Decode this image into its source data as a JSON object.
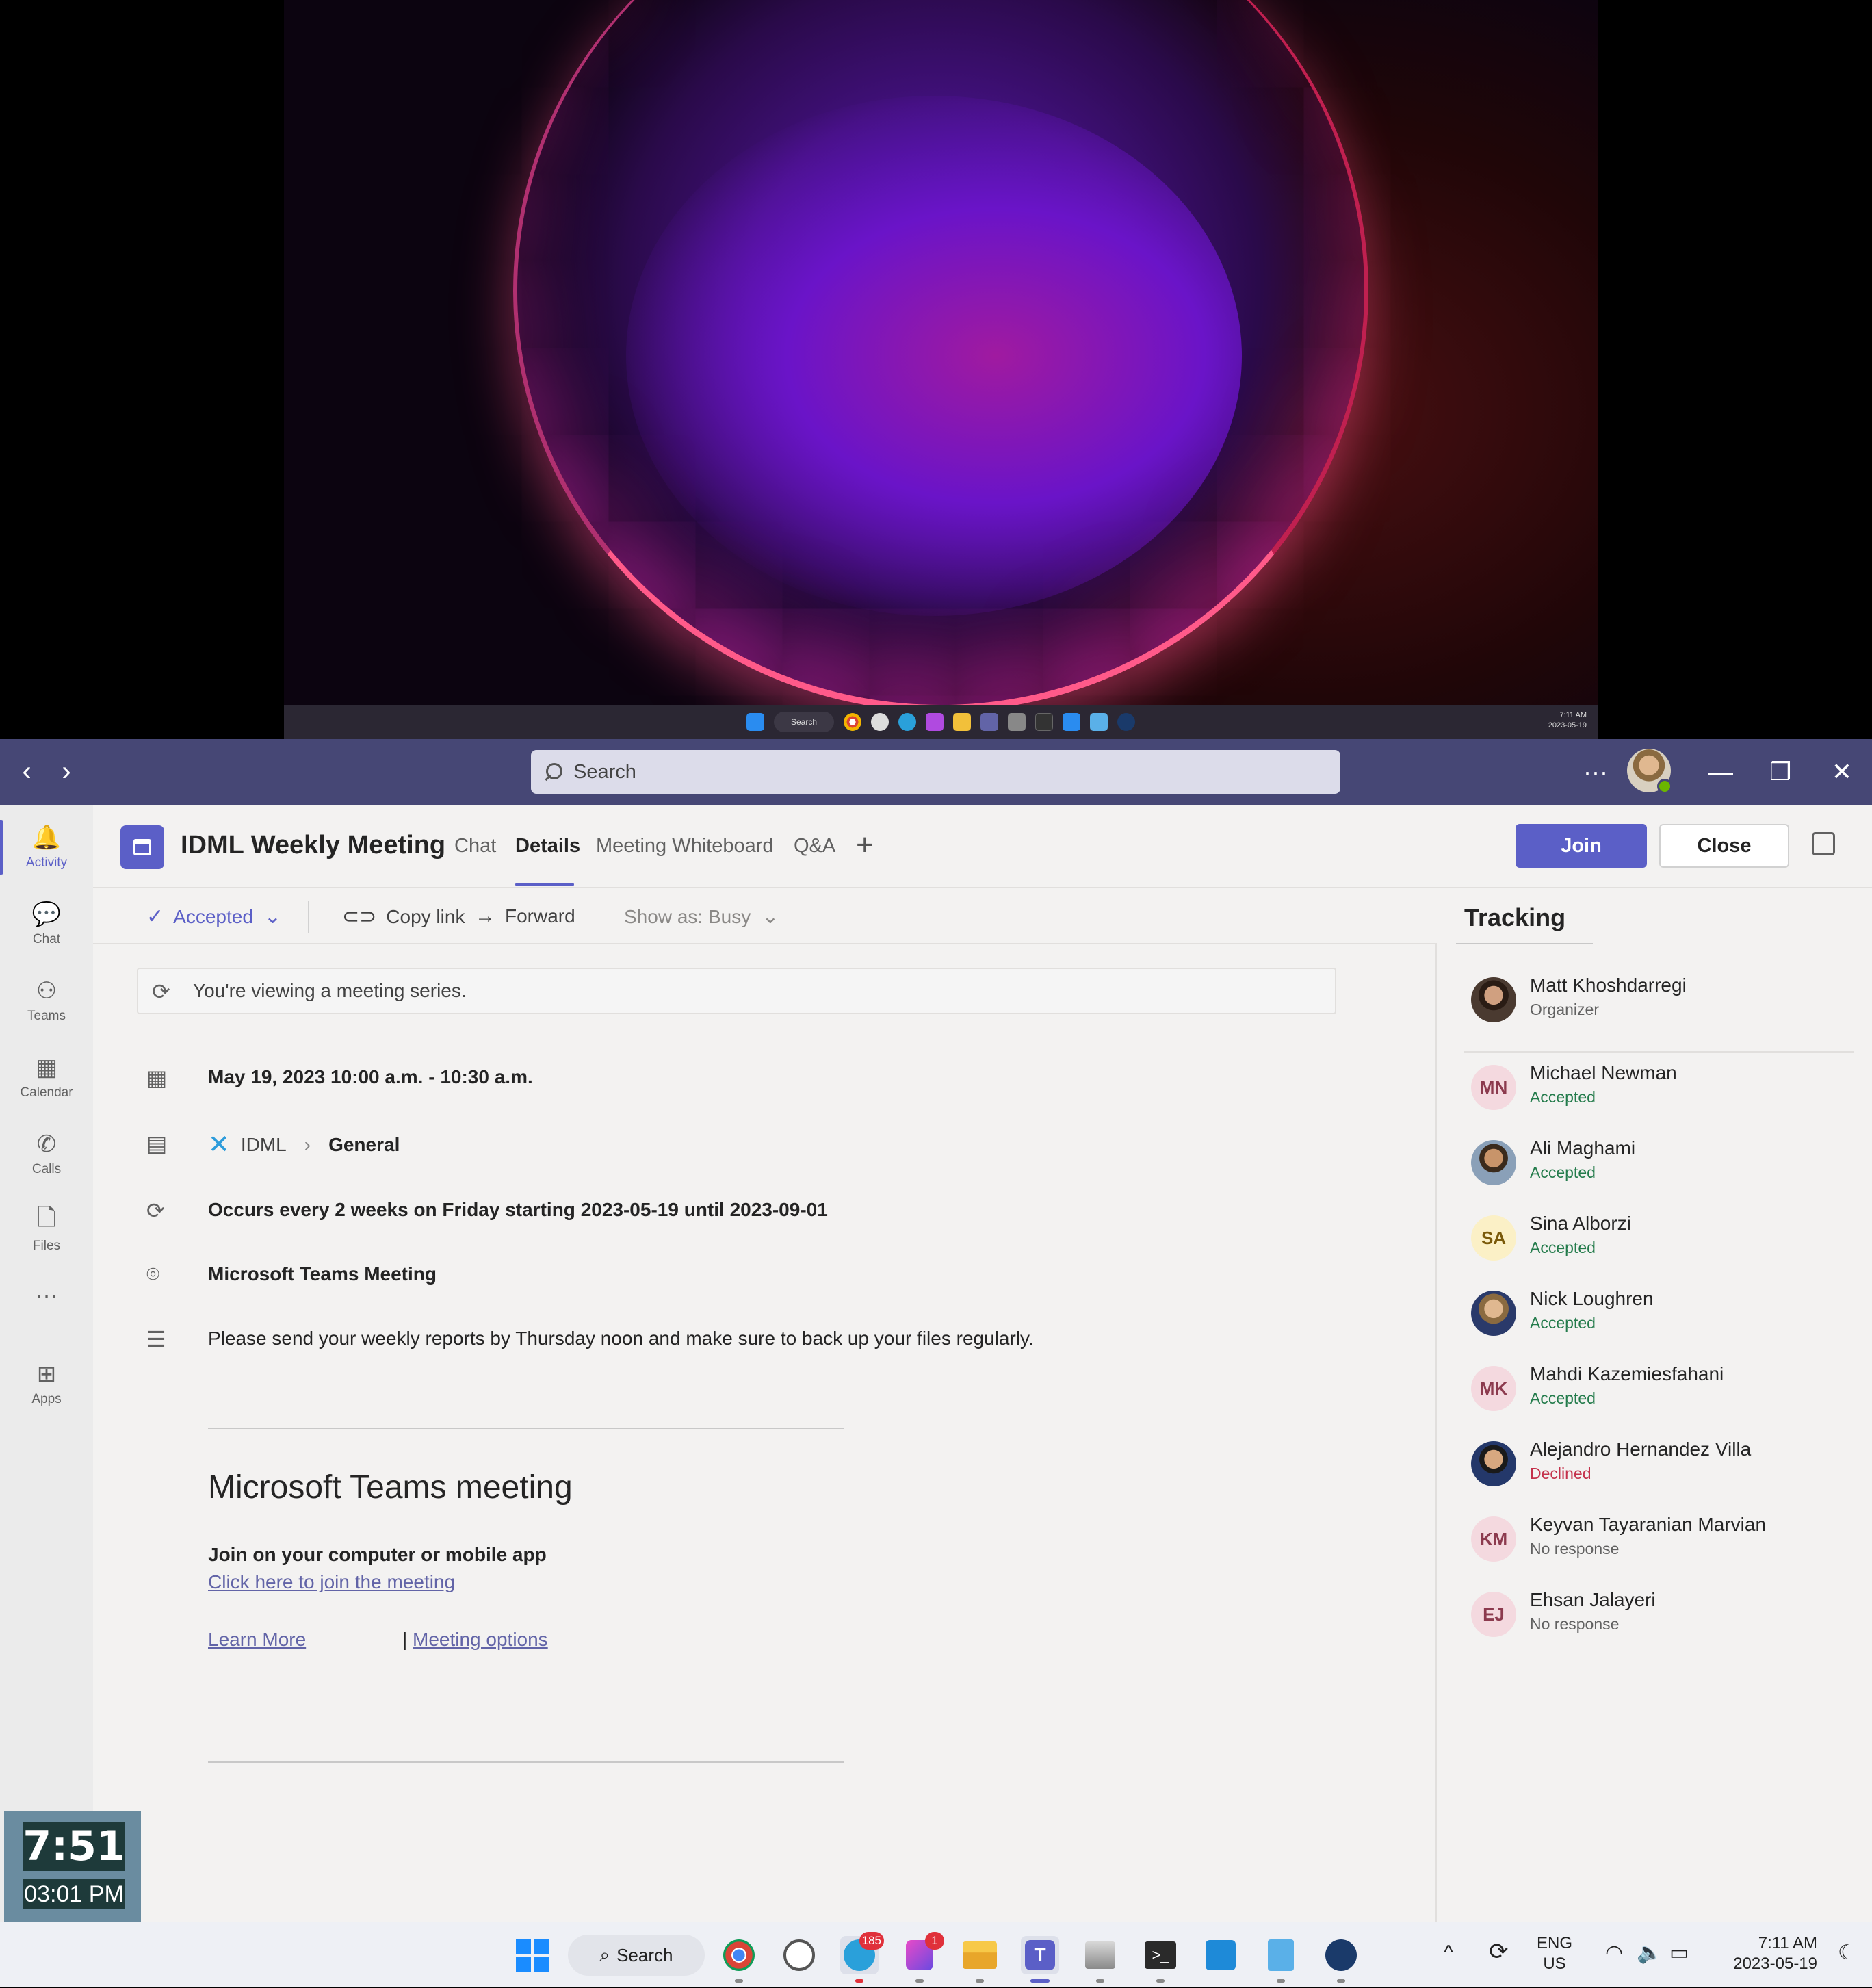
{
  "virtual_desktop": {
    "taskbar_search": "Search",
    "clock_time": "7:11 AM",
    "clock_date": "2023-05-19"
  },
  "titlebar": {
    "search_placeholder": "Search",
    "more": "···",
    "minimize": "—",
    "maximize": "❐",
    "close": "✕",
    "back": "‹",
    "forward": "›"
  },
  "rail": [
    {
      "label": "Activity",
      "icon": "bell-icon",
      "glyph": "🔔"
    },
    {
      "label": "Chat",
      "icon": "chat-icon",
      "glyph": "💬"
    },
    {
      "label": "Teams",
      "icon": "teams-icon",
      "glyph": "⚇"
    },
    {
      "label": "Calendar",
      "icon": "calendar-icon",
      "glyph": "▦"
    },
    {
      "label": "Calls",
      "icon": "phone-icon",
      "glyph": "✆"
    },
    {
      "label": "Files",
      "icon": "file-icon",
      "glyph": "🗋"
    },
    {
      "label": "",
      "icon": "more-icon",
      "glyph": "···"
    },
    {
      "label": "Apps",
      "icon": "apps-icon",
      "glyph": "⊞"
    }
  ],
  "header": {
    "title": "IDML Weekly Meeting",
    "tabs": [
      "Chat",
      "Details",
      "Meeting Whiteboard",
      "Q&A"
    ],
    "active_tab": "Details",
    "add_tab": "+",
    "join": "Join",
    "close": "Close"
  },
  "toolbar": {
    "accepted": "Accepted",
    "copy_link": "Copy link",
    "forward": "Forward",
    "show_as": "Show as: Busy"
  },
  "details": {
    "series_notice": "You're viewing a meeting series.",
    "datetime": "May 19, 2023 10:00 a.m. - 10:30 a.m.",
    "team": "IDML",
    "channel": "General",
    "recurrence": "Occurs every 2 weeks on Friday starting 2023-05-19 until 2023-09-01",
    "location": "Microsoft Teams Meeting",
    "description": "Please send your weekly reports by Thursday noon and make sure to back up your files regularly.",
    "meeting_heading": "Microsoft Teams meeting",
    "join_heading": "Join on your computer or mobile app",
    "join_link": "Click here to join the meeting",
    "learn_more": "Learn More",
    "separator": "|",
    "meeting_options": "Meeting options"
  },
  "tracking": {
    "title": "Tracking",
    "people": [
      {
        "name": "Matt Khoshdarregi",
        "status": "Organizer",
        "initials": ""
      },
      {
        "name": "Michael Newman",
        "status": "Accepted",
        "initials": "MN"
      },
      {
        "name": "Ali Maghami",
        "status": "Accepted",
        "initials": ""
      },
      {
        "name": "Sina Alborzi",
        "status": "Accepted",
        "initials": "SA"
      },
      {
        "name": "Nick Loughren",
        "status": "Accepted",
        "initials": ""
      },
      {
        "name": "Mahdi Kazemiesfahani",
        "status": "Accepted",
        "initials": "MK"
      },
      {
        "name": "Alejandro Hernandez Villa",
        "status": "Declined",
        "initials": ""
      },
      {
        "name": "Keyvan Tayaranian Marvian",
        "status": "No response",
        "initials": "KM"
      },
      {
        "name": "Ehsan Jalayeri",
        "status": "No response",
        "initials": "EJ"
      }
    ]
  },
  "widget": {
    "time": "7:51",
    "date": "03:01 PM"
  },
  "taskbar": {
    "search": "Search",
    "telegram_badge": "185",
    "app_badge": "1",
    "lang_1": "ENG",
    "lang_2": "US",
    "time": "7:11 AM",
    "date": "2023-05-19"
  },
  "colors": {
    "teams_purple": "#464775",
    "accent": "#5b5fc7",
    "accepted_green": "#237b4b",
    "declined_red": "#c4314b"
  }
}
